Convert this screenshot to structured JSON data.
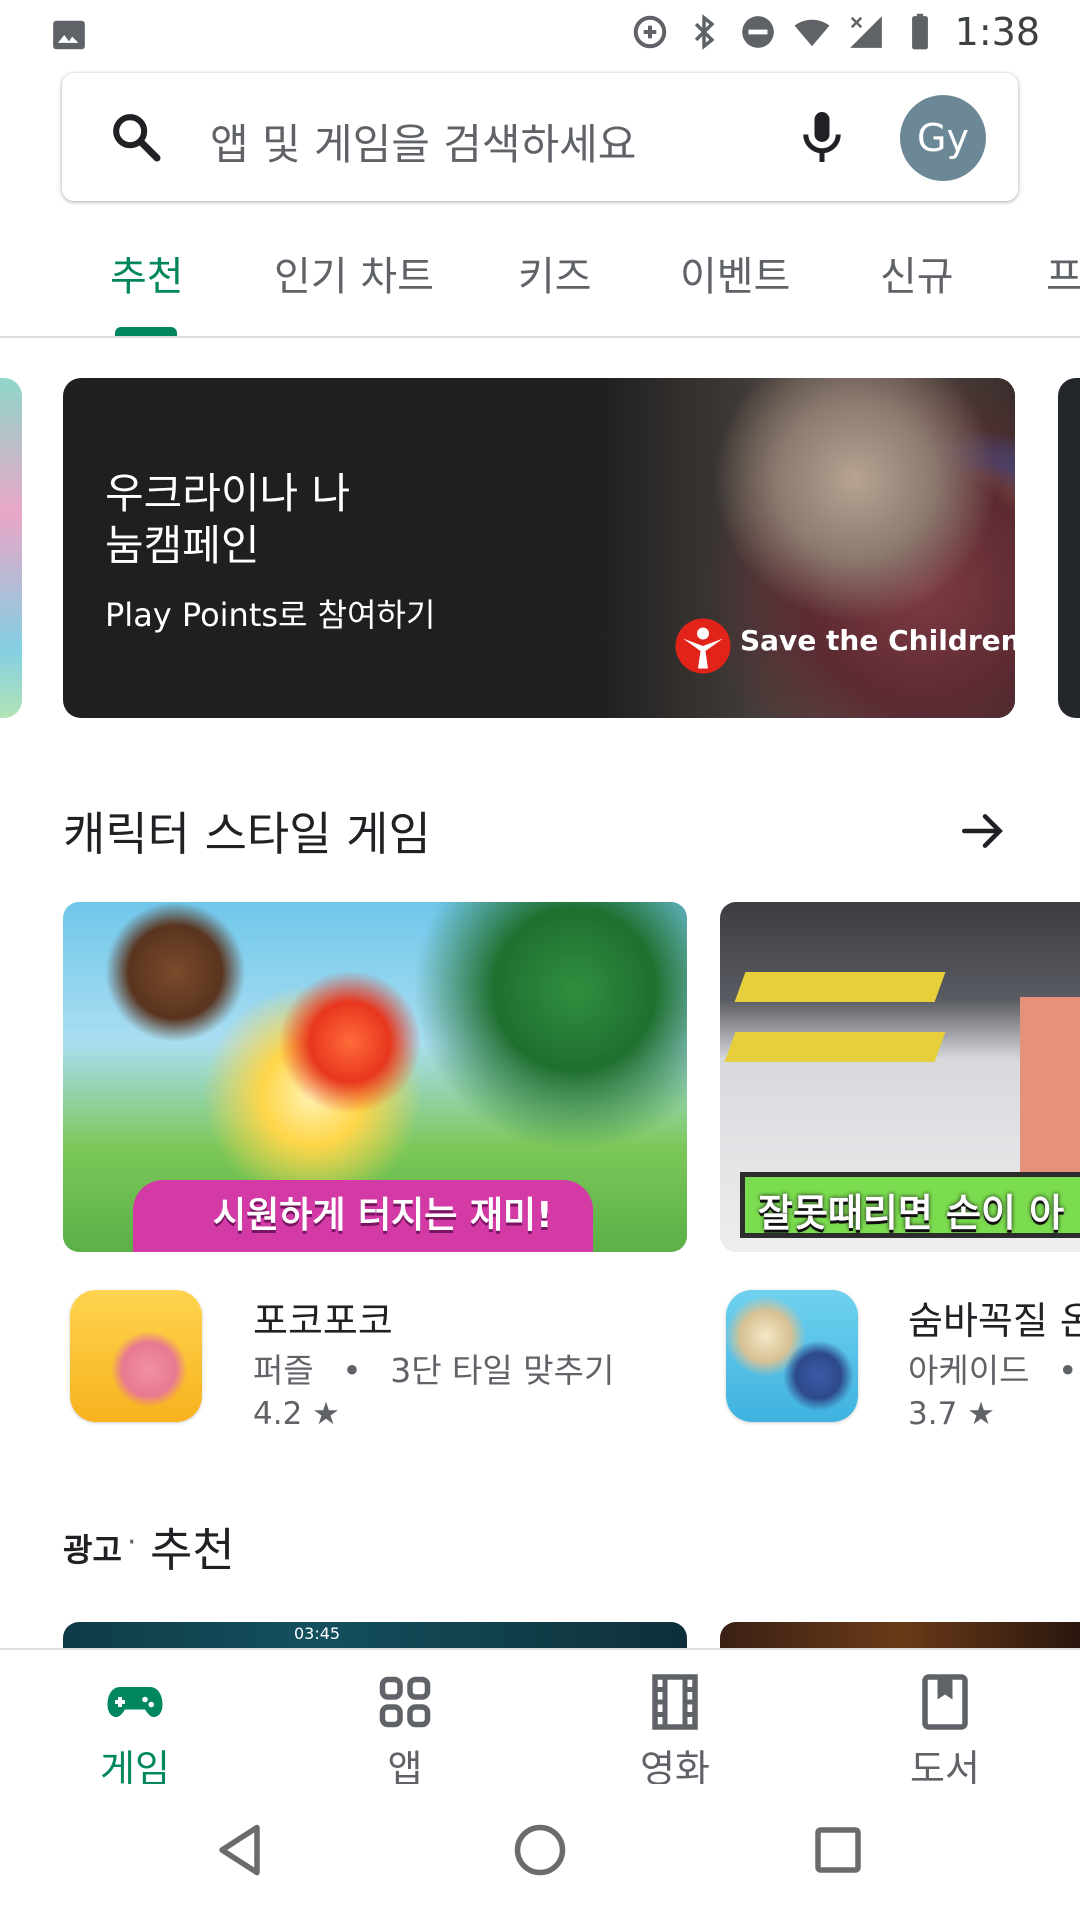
{
  "status_bar": {
    "time": "1:38",
    "icons": [
      "image-icon",
      "data-saver-icon",
      "bluetooth-icon",
      "do-not-disturb-icon",
      "wifi-icon",
      "signal-icon",
      "battery-icon"
    ]
  },
  "search": {
    "placeholder": "앱 및 게임을 검색하세요",
    "avatar_initials": "Gy"
  },
  "tabs": [
    {
      "label": "추천",
      "active": true
    },
    {
      "label": "인기 차트"
    },
    {
      "label": "키즈"
    },
    {
      "label": "이벤트"
    },
    {
      "label": "신규"
    },
    {
      "label": "프"
    }
  ],
  "banner": {
    "title": "우크라이나 나\n눔캠페인",
    "subtitle": "Play Points로 참여하기",
    "logo_text": "Save the Children"
  },
  "section": {
    "title": "캐릭터 스타일 게임"
  },
  "cards": [
    {
      "image_caption": "시원하게 터지는 재미!",
      "name": "포코포코",
      "category": "퍼즐",
      "separator": "•",
      "tag": "3단 타일 맞추기",
      "rating": "4.2"
    },
    {
      "image_caption": "잘못때리면 손이 아",
      "name": "숨바꼭질 온",
      "category": "아케이드",
      "separator": "•",
      "rating": "3.7"
    }
  ],
  "ad_section": {
    "ad_label": "광고",
    "dot": "·",
    "title": "추천",
    "card_time": "03:45"
  },
  "bottom_nav": [
    {
      "label": "게임",
      "icon": "gamepad-icon",
      "active": true
    },
    {
      "label": "앱",
      "icon": "apps-grid-icon"
    },
    {
      "label": "영화",
      "icon": "film-icon"
    },
    {
      "label": "도서",
      "icon": "book-icon"
    }
  ],
  "colors": {
    "accent": "#01875f",
    "banner_bg": "#1f1f1f",
    "avatar_bg": "#6c8796"
  }
}
